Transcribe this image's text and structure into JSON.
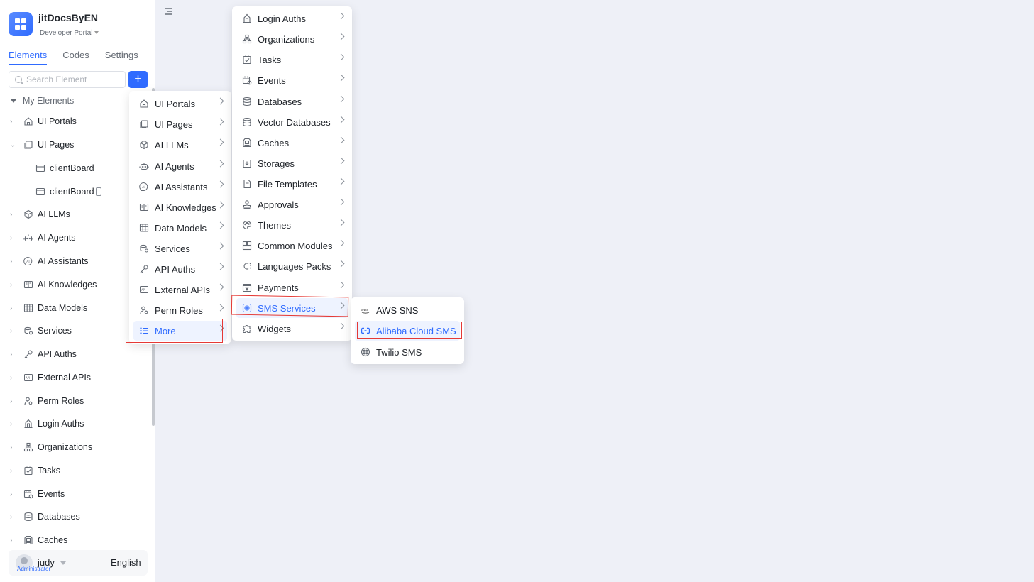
{
  "app": {
    "name": "jitDocsByEN",
    "portal": "Developer Portal"
  },
  "tabs": [
    "Elements",
    "Codes",
    "Settings"
  ],
  "search": {
    "placeholder": "Search Element"
  },
  "add_label": "+",
  "tree": {
    "group": "My Elements",
    "items": [
      {
        "label": "UI Portals",
        "icon": "home-icon"
      },
      {
        "label": "UI Pages",
        "icon": "pages-icon"
      },
      {
        "label": "clientBoard",
        "icon": "window-icon"
      },
      {
        "label": "clientBoard",
        "icon": "window-icon"
      },
      {
        "label": "AI LLMs",
        "icon": "cube-icon"
      },
      {
        "label": "AI Agents",
        "icon": "robot-icon"
      },
      {
        "label": "AI Assistants",
        "icon": "ai-icon"
      },
      {
        "label": "AI Knowledges",
        "icon": "book-icon"
      },
      {
        "label": "Data Models",
        "icon": "table-icon"
      },
      {
        "label": "Services",
        "icon": "service-icon"
      },
      {
        "label": "API Auths",
        "icon": "key-icon"
      },
      {
        "label": "External APIs",
        "icon": "api-icon"
      },
      {
        "label": "Perm Roles",
        "icon": "user-icon"
      },
      {
        "label": "Login Auths",
        "icon": "gate-icon"
      },
      {
        "label": "Organizations",
        "icon": "org-icon"
      },
      {
        "label": "Tasks",
        "icon": "task-icon"
      },
      {
        "label": "Events",
        "icon": "event-icon"
      },
      {
        "label": "Databases",
        "icon": "database-icon"
      },
      {
        "label": "Caches",
        "icon": "cache-icon"
      }
    ]
  },
  "user": {
    "name": "judy",
    "role": "Administrator",
    "language": "English"
  },
  "menu1": {
    "items": [
      {
        "label": "UI Portals",
        "icon": "home-icon"
      },
      {
        "label": "UI Pages",
        "icon": "pages-icon"
      },
      {
        "label": "AI LLMs",
        "icon": "cube-icon"
      },
      {
        "label": "AI Agents",
        "icon": "robot-icon"
      },
      {
        "label": "AI Assistants",
        "icon": "ai-icon"
      },
      {
        "label": "AI Knowledges",
        "icon": "book-icon"
      },
      {
        "label": "Data Models",
        "icon": "table-icon"
      },
      {
        "label": "Services",
        "icon": "service-icon"
      },
      {
        "label": "API Auths",
        "icon": "key-icon"
      },
      {
        "label": "External APIs",
        "icon": "api-icon"
      },
      {
        "label": "Perm Roles",
        "icon": "user-icon"
      },
      {
        "label": "More",
        "icon": "list-icon"
      }
    ]
  },
  "menu2": {
    "items": [
      {
        "label": "Login Auths",
        "icon": "gate-icon"
      },
      {
        "label": "Organizations",
        "icon": "org-icon"
      },
      {
        "label": "Tasks",
        "icon": "task-icon"
      },
      {
        "label": "Events",
        "icon": "event-icon"
      },
      {
        "label": "Databases",
        "icon": "database-icon"
      },
      {
        "label": "Vector Databases",
        "icon": "database-icon"
      },
      {
        "label": "Caches",
        "icon": "cache-icon"
      },
      {
        "label": "Storages",
        "icon": "storage-icon"
      },
      {
        "label": "File Templates",
        "icon": "file-icon"
      },
      {
        "label": "Approvals",
        "icon": "stamp-icon"
      },
      {
        "label": "Themes",
        "icon": "palette-icon"
      },
      {
        "label": "Common Modules",
        "icon": "module-icon"
      },
      {
        "label": "Languages Packs",
        "icon": "language-icon"
      },
      {
        "label": "Payments",
        "icon": "payment-icon"
      },
      {
        "label": "SMS Services",
        "icon": "sms-icon"
      },
      {
        "label": "Widgets",
        "icon": "puzzle-icon"
      }
    ]
  },
  "menu3": {
    "items": [
      {
        "label": "AWS SNS",
        "icon": "aws-icon"
      },
      {
        "label": "Alibaba Cloud SMS",
        "icon": "alibaba-icon"
      },
      {
        "label": "Twilio SMS",
        "icon": "twilio-icon"
      }
    ]
  },
  "colors": {
    "accent": "#2f6bff",
    "highlight": "#e53935",
    "canvas": "#eef0f7"
  }
}
